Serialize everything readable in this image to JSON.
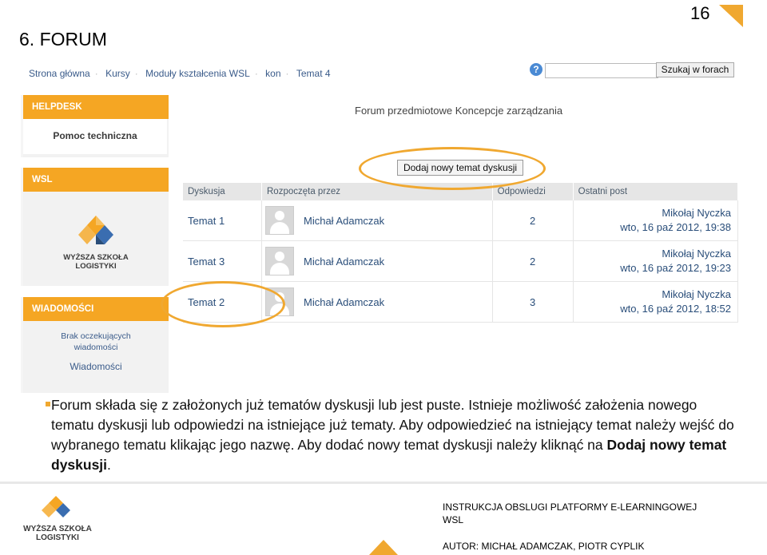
{
  "slide": {
    "title": "6. FORUM",
    "page_number": "16"
  },
  "breadcrumb": [
    "Strona główna",
    "Kursy",
    "Moduły kształcenia WSL",
    "kon",
    "Temat 4"
  ],
  "search": {
    "help_label": "?",
    "button_label": "Szukaj w forach",
    "value": ""
  },
  "sidebar": {
    "helpdesk": {
      "heading": "HELPDESK",
      "link": "Pomoc techniczna"
    },
    "wsl": {
      "heading": "WSL",
      "logo_line1": "WYŻSZA SZKOŁA",
      "logo_line2": "LOGISTYKI"
    },
    "messages": {
      "heading": "WIADOMOŚCI",
      "status_line1": "Brak oczekujących",
      "status_line2": "wiadomości",
      "link": "Wiadomości"
    }
  },
  "forum": {
    "title": "Forum przedmiotowe Koncepcje zarządzania",
    "add_button": "Dodaj nowy temat dyskusji",
    "columns": [
      "Dyskusja",
      "Rozpoczęta przez",
      "Odpowiedzi",
      "Ostatni post"
    ],
    "rows": [
      {
        "topic": "Temat 1",
        "author": "Michał Adamczak",
        "replies": "2",
        "last_user": "Mikołaj Nyczka",
        "last_date": "wto, 16 paź 2012, 19:38"
      },
      {
        "topic": "Temat 3",
        "author": "Michał Adamczak",
        "replies": "2",
        "last_user": "Mikołaj Nyczka",
        "last_date": "wto, 16 paź 2012, 19:23"
      },
      {
        "topic": "Temat 2",
        "author": "Michał Adamczak",
        "replies": "3",
        "last_user": "Mikołaj Nyczka",
        "last_date": "wto, 16 paź 2012, 18:52"
      }
    ]
  },
  "description": {
    "text": "Forum składa się z założonych już tematów dyskusji lub jest puste. Istnieje możliwość założenia nowego tematu dyskusji lub odpowiedzi na istniejące już tematy. Aby odpowiedzieć na istniejący temat należy wejść do wybranego tematu klikając jego nazwę. Aby dodać nowy temat dyskusji należy kliknąć na ",
    "bold": "Dodaj nowy temat dyskusji",
    "end": "."
  },
  "footer": {
    "logo_line1": "WYŻSZA SZKOŁA",
    "logo_line2": "LOGISTYKI",
    "line1": "INSTRUKCJA OBSLUGI PLATFORMY E-LEARNINGOWEJ",
    "line2": "WSL",
    "line3": "AUTOR: MICHAŁ ADAMCZAK, PIOTR CYPLIK"
  },
  "colors": {
    "accent": "#f5a623",
    "ring": "#f0a830",
    "link": "#2a4e7a"
  }
}
